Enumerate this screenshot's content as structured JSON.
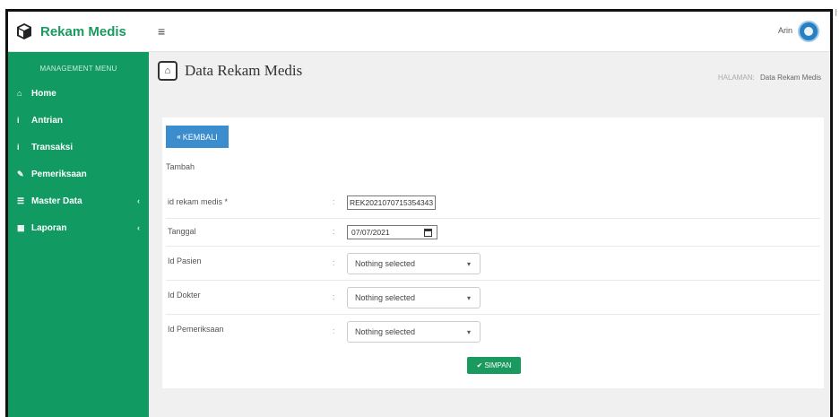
{
  "brand": {
    "name": "Rekam Medis",
    "icon": "cube-icon"
  },
  "sidebar": {
    "header": "MANAGEMENT MENU",
    "items": [
      {
        "icon": "home-icon",
        "glyph": "⌂",
        "label": "Home"
      },
      {
        "icon": "info-icon",
        "glyph": "i",
        "label": "Antrian"
      },
      {
        "icon": "info-icon",
        "glyph": "i",
        "label": "Transaksi"
      },
      {
        "icon": "edit-icon",
        "glyph": "✎",
        "label": "Pemeriksaan"
      },
      {
        "icon": "database-icon",
        "glyph": "☰",
        "label": "Master Data",
        "chevron": "‹"
      },
      {
        "icon": "calendar-icon",
        "glyph": "▦",
        "label": "Laporan",
        "chevron": "‹"
      }
    ]
  },
  "topbar": {
    "menu_glyph": "≡",
    "user": "Arin"
  },
  "page": {
    "title": "Data Rekam Medis",
    "breadcrumb_label": "HALAMAN:",
    "breadcrumb_current": "Data Rekam Medis"
  },
  "form": {
    "back_label": "KEMBALI",
    "back_glyph": "«",
    "heading": "Tambah",
    "fields": {
      "id_rekam_medis": {
        "label": "id rekam medis *",
        "value": "REK2021070715354343"
      },
      "tanggal": {
        "label": "Tanggal",
        "value": "07/07/2021"
      },
      "id_pasien": {
        "label": "Id Pasien",
        "value": "Nothing selected"
      },
      "id_dokter": {
        "label": "Id Dokter",
        "value": "Nothing selected"
      },
      "id_pemeriksaan": {
        "label": "Id Pemeriksaan",
        "value": "Nothing selected"
      }
    },
    "colon": ":",
    "caret": "▾",
    "save_label": "SIMPAN",
    "save_glyph": "✔"
  }
}
